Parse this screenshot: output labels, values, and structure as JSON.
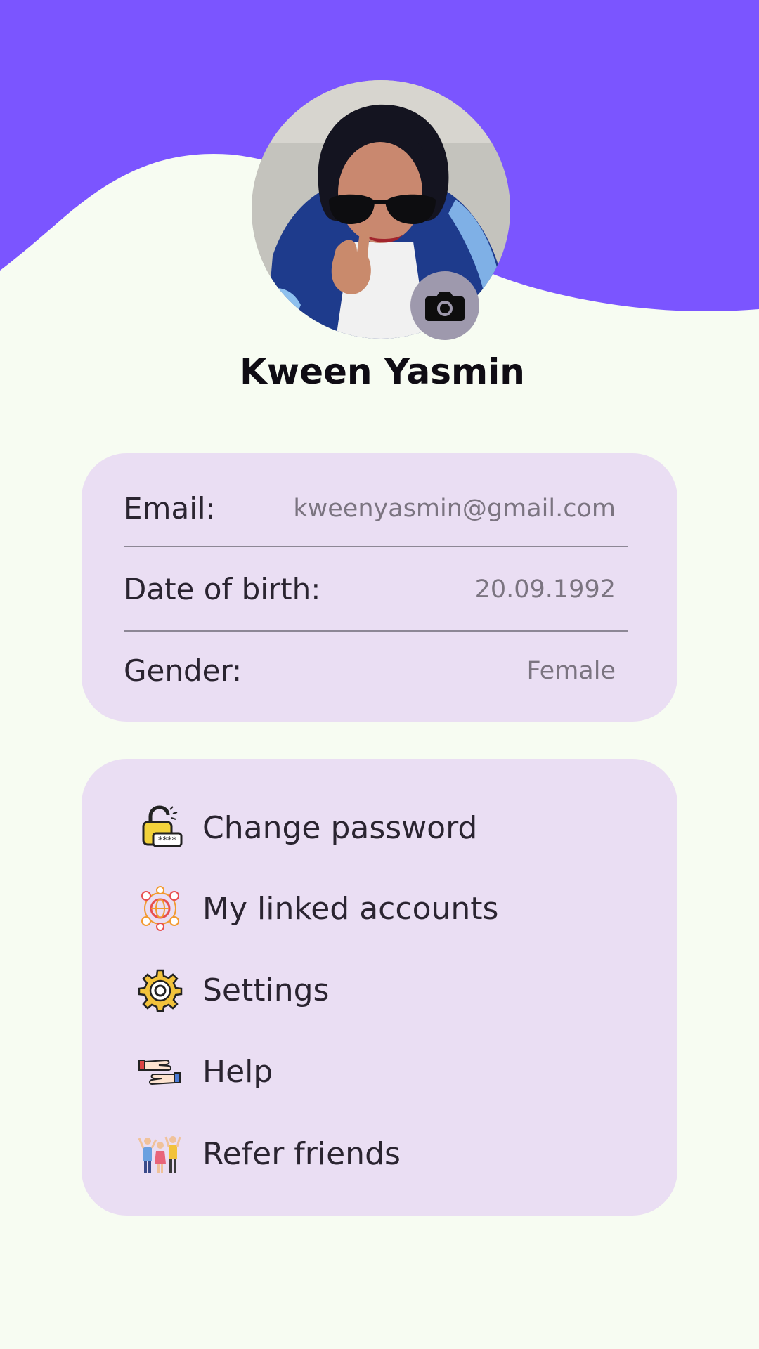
{
  "header": {
    "background_color": "#7b55ff"
  },
  "profile": {
    "name": "Kween Yasmin",
    "avatar_icon": "profile-photo",
    "camera_icon": "camera-icon"
  },
  "info": {
    "email_label": "Email:",
    "email_value": "kweenyasmin@gmail.com",
    "dob_label": "Date of birth:",
    "dob_value": "20.09.1992",
    "gender_label": "Gender:",
    "gender_value": "Female"
  },
  "menu": {
    "items": [
      {
        "label": "Change password",
        "icon": "padlock-password-icon"
      },
      {
        "label": "My linked accounts",
        "icon": "globe-network-icon"
      },
      {
        "label": "Settings",
        "icon": "gear-icon"
      },
      {
        "label": "Help",
        "icon": "helping-hands-icon"
      },
      {
        "label": "Refer friends",
        "icon": "group-friends-icon"
      }
    ]
  },
  "colors": {
    "card": "#eadef3",
    "background": "#f7fcf2",
    "accent": "#7b55ff"
  }
}
